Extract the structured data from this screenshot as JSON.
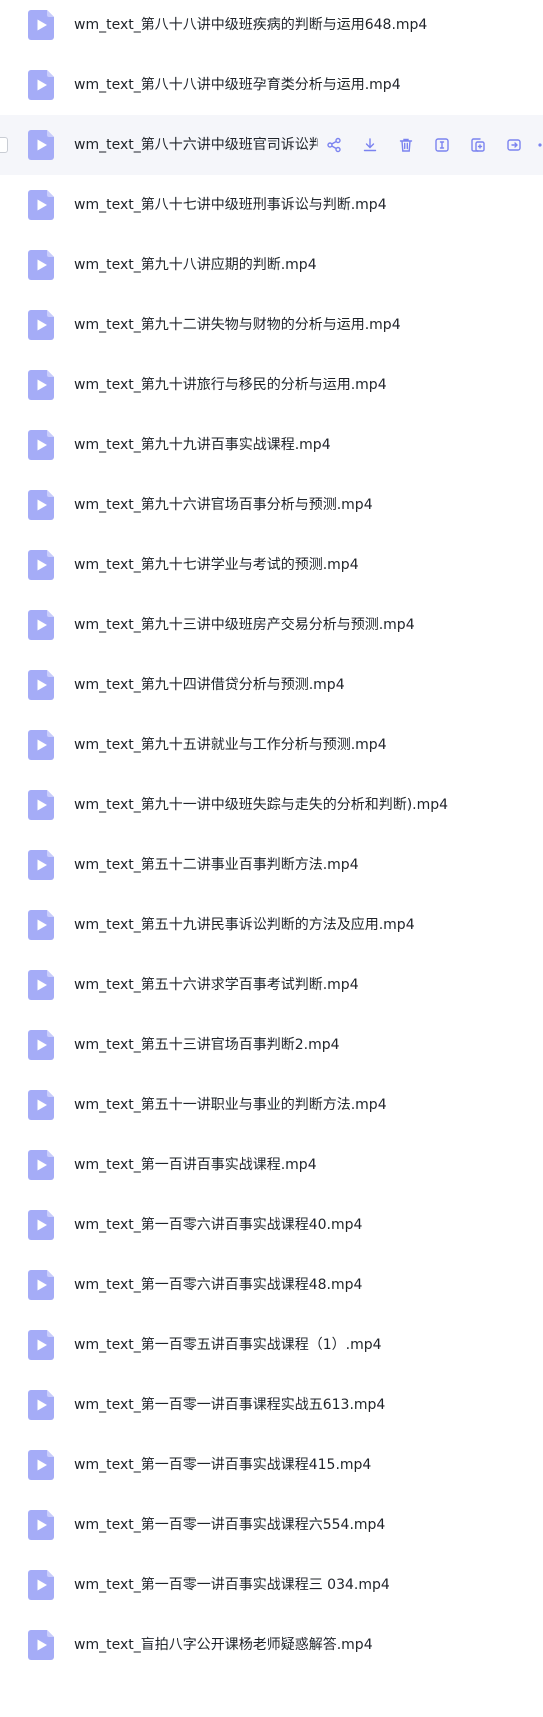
{
  "colors": {
    "accent": "#7b83f0",
    "icon_fill": "#a5acf7",
    "icon_corner": "#c9cdfb",
    "hover_bg": "#f5f6fa",
    "text": "#1f2329"
  },
  "hover_actions": [
    {
      "name": "share-icon"
    },
    {
      "name": "download-icon"
    },
    {
      "name": "delete-icon"
    },
    {
      "name": "rename-icon"
    },
    {
      "name": "copy-icon"
    },
    {
      "name": "move-icon"
    }
  ],
  "files": [
    {
      "name": "wm_text_第八十八讲中级班疾病的判断与运用648.mp4"
    },
    {
      "name": "wm_text_第八十八讲中级班孕育类分析与运用.mp4"
    },
    {
      "name": "wm_text_第八十六讲中级班官司诉讼判断与运用.mp4",
      "hovered": true
    },
    {
      "name": "wm_text_第八十七讲中级班刑事诉讼与判断.mp4"
    },
    {
      "name": "wm_text_第九十八讲应期的判断.mp4"
    },
    {
      "name": "wm_text_第九十二讲失物与财物的分析与运用.mp4"
    },
    {
      "name": "wm_text_第九十讲旅行与移民的分析与运用.mp4"
    },
    {
      "name": "wm_text_第九十九讲百事实战课程.mp4"
    },
    {
      "name": "wm_text_第九十六讲官场百事分析与预测.mp4"
    },
    {
      "name": "wm_text_第九十七讲学业与考试的预测.mp4"
    },
    {
      "name": "wm_text_第九十三讲中级班房产交易分析与预测.mp4"
    },
    {
      "name": "wm_text_第九十四讲借贷分析与预测.mp4"
    },
    {
      "name": "wm_text_第九十五讲就业与工作分析与预测.mp4"
    },
    {
      "name": "wm_text_第九十一讲中级班失踪与走失的分析和判断).mp4"
    },
    {
      "name": "wm_text_第五十二讲事业百事判断方法.mp4"
    },
    {
      "name": "wm_text_第五十九讲民事诉讼判断的方法及应用.mp4"
    },
    {
      "name": "wm_text_第五十六讲求学百事考试判断.mp4"
    },
    {
      "name": "wm_text_第五十三讲官场百事判断2.mp4"
    },
    {
      "name": "wm_text_第五十一讲职业与事业的判断方法.mp4"
    },
    {
      "name": "wm_text_第一百讲百事实战课程.mp4"
    },
    {
      "name": "wm_text_第一百零六讲百事实战课程40.mp4"
    },
    {
      "name": "wm_text_第一百零六讲百事实战课程48.mp4"
    },
    {
      "name": "wm_text_第一百零五讲百事实战课程（1）.mp4"
    },
    {
      "name": "wm_text_第一百零一讲百事课程实战五613.mp4"
    },
    {
      "name": "wm_text_第一百零一讲百事实战课程415.mp4"
    },
    {
      "name": "wm_text_第一百零一讲百事实战课程六554.mp4"
    },
    {
      "name": "wm_text_第一百零一讲百事实战课程三 034.mp4"
    },
    {
      "name": "wm_text_盲拍八字公开课杨老师疑惑解答.mp4"
    }
  ]
}
